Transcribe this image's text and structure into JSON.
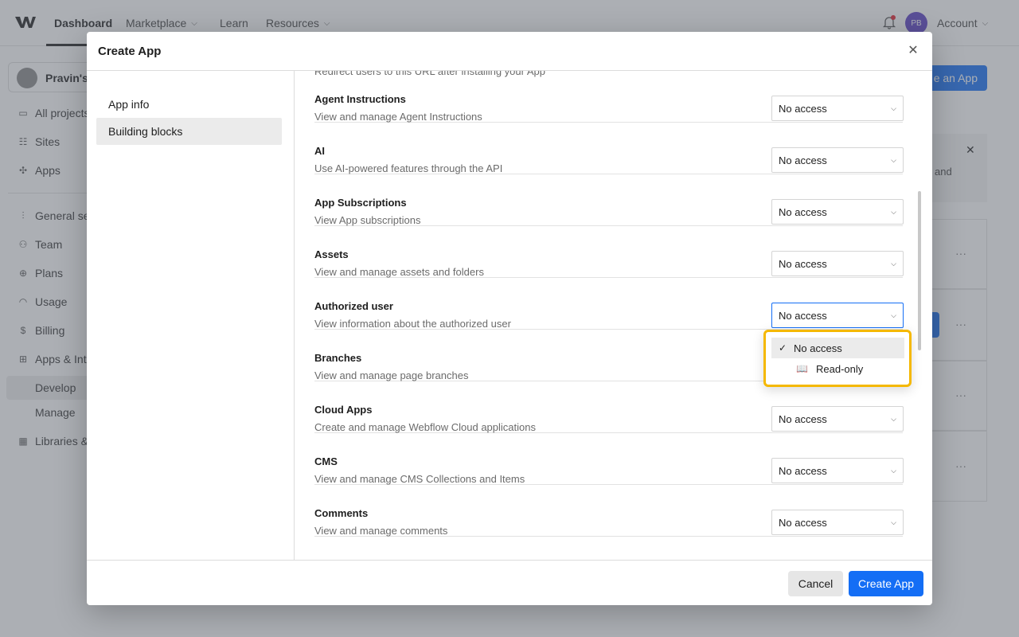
{
  "topnav": {
    "tabs": [
      {
        "label": "Dashboard"
      },
      {
        "label": "Marketplace"
      },
      {
        "label": "Learn"
      },
      {
        "label": "Resources"
      }
    ],
    "avatar_initials": "PB",
    "account_label": "Account"
  },
  "sidebar": {
    "workspace_name": "Pravin's",
    "items": [
      {
        "label": "All projects",
        "icon": "folder-icon"
      },
      {
        "label": "Sites",
        "icon": "sites-icon"
      },
      {
        "label": "Apps",
        "icon": "apps-icon"
      },
      {
        "label": "General se",
        "icon": "sliders-icon"
      },
      {
        "label": "Team",
        "icon": "team-icon"
      },
      {
        "label": "Plans",
        "icon": "plans-icon"
      },
      {
        "label": "Usage",
        "icon": "usage-icon"
      },
      {
        "label": "Billing",
        "icon": "dollar-icon"
      },
      {
        "label": "Apps & Inte",
        "icon": "integrations-icon"
      },
      {
        "label": "Develop",
        "icon": ""
      },
      {
        "label": "Manage",
        "icon": ""
      },
      {
        "label": "Libraries &",
        "icon": "library-icon"
      }
    ]
  },
  "background": {
    "create_button": "e an App",
    "banner_text": "and"
  },
  "modal": {
    "title": "Create App",
    "nav": [
      {
        "label": "App info"
      },
      {
        "label": "Building blocks"
      }
    ],
    "cut_off_description": "Redirect users to this URL after installing your App",
    "permissions": [
      {
        "name": "Agent Instructions",
        "description": "View and manage Agent Instructions",
        "value": "No access"
      },
      {
        "name": "AI",
        "description": "Use AI-powered features through the API",
        "value": "No access"
      },
      {
        "name": "App Subscriptions",
        "description": "View App subscriptions",
        "value": "No access"
      },
      {
        "name": "Assets",
        "description": "View and manage assets and folders",
        "value": "No access"
      },
      {
        "name": "Authorized user",
        "description": "View information about the authorized user",
        "value": "No access"
      },
      {
        "name": "Branches",
        "description": "View and manage page branches",
        "value": ""
      },
      {
        "name": "Cloud Apps",
        "description": "Create and manage Webflow Cloud applications",
        "value": "No access"
      },
      {
        "name": "CMS",
        "description": "View and manage CMS Collections and Items",
        "value": "No access"
      },
      {
        "name": "Comments",
        "description": "View and manage comments",
        "value": "No access"
      }
    ],
    "dropdown_options": [
      {
        "label": "No access",
        "icon": "check-icon",
        "selected": true
      },
      {
        "label": "Read-only",
        "icon": "book-icon",
        "selected": false
      }
    ],
    "cancel_label": "Cancel",
    "create_label": "Create App"
  },
  "colors": {
    "accent": "#146ef5",
    "highlight": "#f5b800",
    "notification": "#e5202e"
  }
}
